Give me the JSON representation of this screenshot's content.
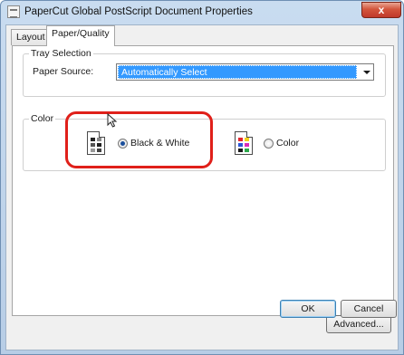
{
  "window": {
    "title": "PaperCut Global PostScript Document Properties",
    "close_symbol": "x"
  },
  "tabs": [
    {
      "label": "Layout",
      "active": false
    },
    {
      "label": "Paper/Quality",
      "active": true
    }
  ],
  "tray_selection": {
    "group_title": "Tray Selection",
    "paper_source_label": "Paper Source:",
    "paper_source_value": "Automatically Select"
  },
  "color": {
    "group_title": "Color",
    "options": [
      {
        "label": "Black & White",
        "selected": true,
        "icon": "bw-document-icon"
      },
      {
        "label": "Color",
        "selected": false,
        "icon": "color-document-icon"
      }
    ],
    "highlight_color": "#e0201a"
  },
  "buttons": {
    "advanced": "Advanced...",
    "ok": "OK",
    "cancel": "Cancel"
  },
  "colors": {
    "selection_blue": "#3399ff",
    "title_bar": "#c9dcf0",
    "close_button": "#c0392b"
  }
}
